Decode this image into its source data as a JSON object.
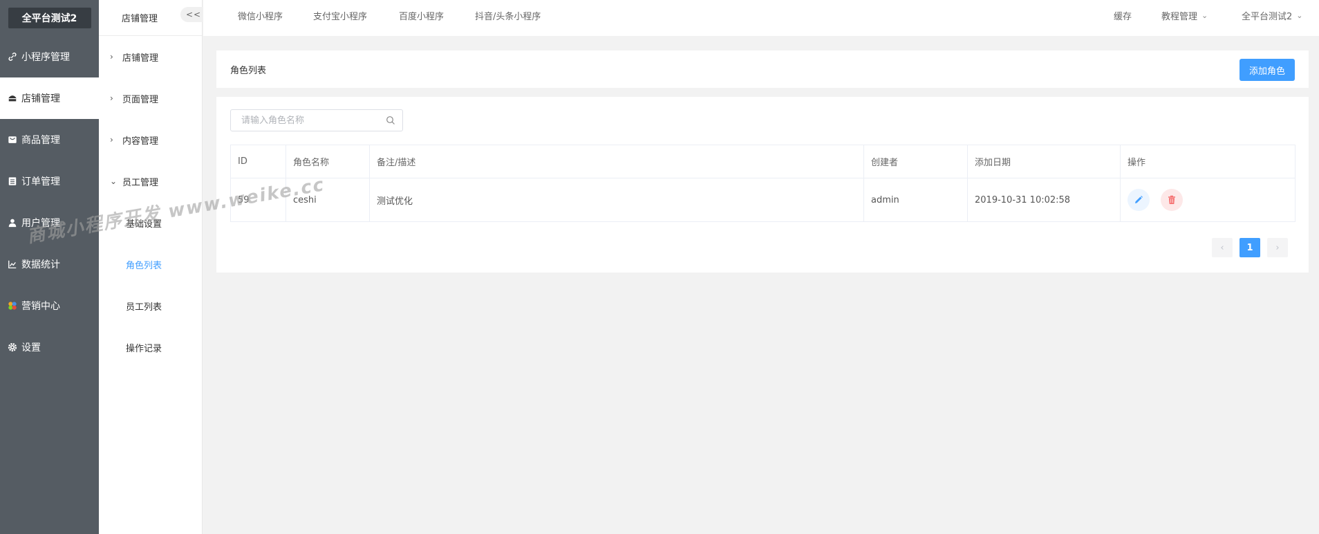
{
  "app": {
    "brand": "全平台测试2"
  },
  "sidebar": {
    "items": [
      {
        "label": "小程序管理",
        "icon": "link-icon"
      },
      {
        "label": "店铺管理",
        "icon": "store-icon"
      },
      {
        "label": "商品管理",
        "icon": "goods-icon"
      },
      {
        "label": "订单管理",
        "icon": "order-icon"
      },
      {
        "label": "用户管理",
        "icon": "user-icon"
      },
      {
        "label": "数据统计",
        "icon": "chart-icon"
      },
      {
        "label": "营销中心",
        "icon": "marketing-icon"
      },
      {
        "label": "设置",
        "icon": "gear-icon"
      }
    ]
  },
  "subnav": {
    "header": "店铺管理",
    "collapse": "<<",
    "groups": [
      {
        "label": "店铺管理"
      },
      {
        "label": "页面管理"
      },
      {
        "label": "内容管理"
      },
      {
        "label": "员工管理"
      }
    ],
    "children": [
      "基础设置",
      "角色列表",
      "员工列表",
      "操作记录"
    ]
  },
  "topbar": {
    "tabs": [
      "微信小程序",
      "支付宝小程序",
      "百度小程序",
      "抖音/头条小程序"
    ],
    "right": [
      "缓存",
      "教程管理",
      "全平台测试2"
    ]
  },
  "page": {
    "title": "角色列表",
    "add_button": "添加角色",
    "search_placeholder": "请输入角色名称"
  },
  "table": {
    "headers": [
      "ID",
      "角色名称",
      "备注/描述",
      "创建者",
      "添加日期",
      "操作"
    ],
    "rows": [
      {
        "id": "59",
        "name": "ceshi",
        "desc": "测试优化",
        "creator": "admin",
        "date": "2019-10-31 10:02:58"
      }
    ]
  },
  "pagination": {
    "prev": "‹",
    "current": "1",
    "next": "›"
  },
  "watermark": "商城小程序开发 www.weike.cc",
  "colors": {
    "primary": "#409eff",
    "sidebar": "#555c63",
    "danger": "#f56c6c"
  }
}
